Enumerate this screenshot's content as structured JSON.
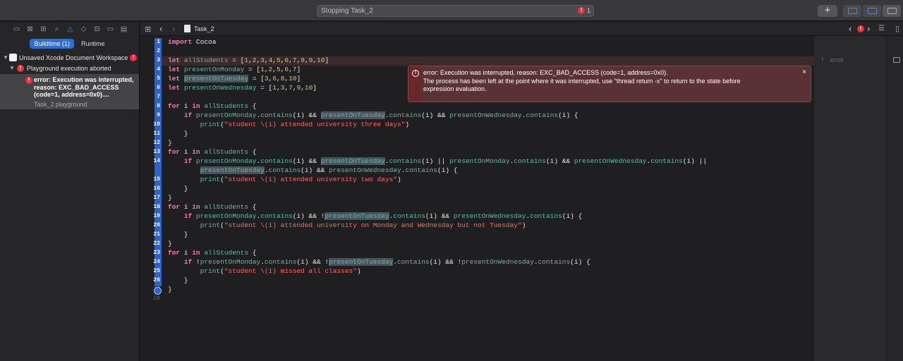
{
  "toolbar": {
    "status_text": "Stopping Task_2",
    "status_error_count": "1",
    "add_label": "+"
  },
  "navigator": {
    "tabs": [
      {
        "label": "Buildtime (1)"
      },
      {
        "label": "Runtime"
      }
    ],
    "workspace": "Unsaved Xcode Document Workspace",
    "group": "Playground execution aborted",
    "issue_text": "error: Execution was interrupted, reason: EXC_BAD_ACCESS (code=1, address=0x0)....",
    "issue_file": "Task_2.playground"
  },
  "jumpbar": {
    "file": "Task_2"
  },
  "error_popup": {
    "line1": "error: Execution was interrupted, reason: EXC_BAD_ACCESS (code=1, address=0x0).",
    "line2": "The process has been left at the point where it was interrupted, use \"thread return -x\" to return to the state before",
    "line3": "expression evaluation."
  },
  "results": {
    "error_label": "error"
  },
  "line_numbers": [
    "1",
    "2",
    "3",
    "4",
    "5",
    "6",
    "7",
    "8",
    "9",
    "10",
    "11",
    "12",
    "13",
    "14",
    "",
    "15",
    "16",
    "17",
    "18",
    "19",
    "20",
    "21",
    "22",
    "23",
    "24",
    "25",
    "26",
    "27",
    "28"
  ],
  "colors": {
    "accent": "#2d6fd8",
    "error": "#e8323a",
    "keyword": "#ff7ab2",
    "identifier": "#67b7a4",
    "number": "#d9c97c",
    "string": "#fc6a5d"
  }
}
